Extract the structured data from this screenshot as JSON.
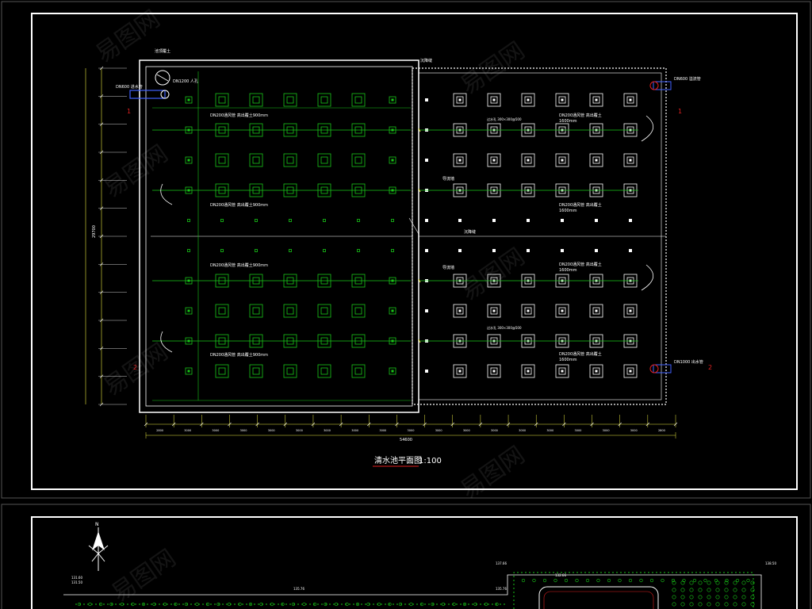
{
  "drawing": {
    "title": "清水池平面图",
    "scale": "1:100",
    "watermark": "易图网"
  },
  "tank_plan": {
    "left_top_note": "池顶覆土",
    "right_top_note": "沉降缝",
    "mid_note": "沉降缝",
    "manhole": "DN1200 人孔",
    "inlet_pipe": "DN600 进水管",
    "overflow_pipe": "DN600 溢流管",
    "outlet_pipe": "DN1000 出水管",
    "deflector_label": "导流墙",
    "vent_labels_left": [
      "DN200通风管  高出覆土900mm",
      "DN200通风管  高出覆土900mm",
      "DN200通风管  高出覆土900mm",
      "DN200通风管  高出覆土900mm"
    ],
    "vent_labels_right": [
      "DN200通风管  高出覆土",
      "DN200通风管  高出覆土",
      "DN200通风管  高出覆土",
      "DN200通风管  高出覆土"
    ],
    "vent_height": "1600mm",
    "slot_label": "过水孔 300×300@500",
    "section_marks": [
      "1",
      "1",
      "2",
      "2"
    ],
    "dim_total": "54600",
    "dim_width": "29700",
    "dim_segments": [
      "2800",
      "3000",
      "3000",
      "3000",
      "3000",
      "3000",
      "3000",
      "3000",
      "3000",
      "3000",
      "3000",
      "3000",
      "3000",
      "3000",
      "3000",
      "3000",
      "3000",
      "3000",
      "2800"
    ]
  },
  "site_plan": {
    "elevations": [
      "131.60",
      "131.50",
      "135.76",
      "135.76",
      "132.66",
      "137.66",
      "138.50"
    ],
    "north_arrow": "N"
  },
  "colors": {
    "background": "#000000",
    "frame": "#ffffff",
    "green": "#18c818",
    "yellow": "#e8e840",
    "red": "#e02020",
    "blue": "#4060ff"
  }
}
